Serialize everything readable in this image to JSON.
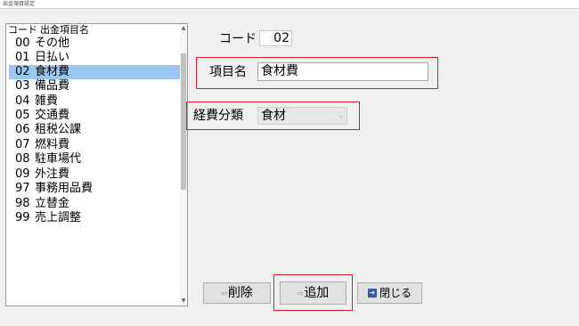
{
  "window": {
    "title": "出金項目設定"
  },
  "list": {
    "headers": [
      "コード",
      "出金項目名"
    ],
    "rows": [
      {
        "code": "00",
        "name": "その他"
      },
      {
        "code": "01",
        "name": "日払い"
      },
      {
        "code": "02",
        "name": "食材費"
      },
      {
        "code": "03",
        "name": "備品費"
      },
      {
        "code": "04",
        "name": "雑費"
      },
      {
        "code": "05",
        "name": "交通費"
      },
      {
        "code": "06",
        "name": "租税公課"
      },
      {
        "code": "07",
        "name": "燃料費"
      },
      {
        "code": "08",
        "name": "駐車場代"
      },
      {
        "code": "09",
        "name": "外注費"
      },
      {
        "code": "97",
        "name": "事務用品費"
      },
      {
        "code": "98",
        "name": "立替金"
      },
      {
        "code": "99",
        "name": "売上調整"
      }
    ],
    "selected_index": 2
  },
  "form": {
    "code_label": "コード",
    "code_value": "02",
    "item_label": "項目名",
    "item_value": "食材費",
    "category_label": "経費分類",
    "category_value": "食材"
  },
  "buttons": {
    "delete_label": "削除",
    "add_label": "追加",
    "close_label": "閉じる"
  },
  "colors": {
    "selected_row": "#99c8f2",
    "highlight_border": "#d61f2a",
    "close_icon": "#2f5da9"
  },
  "icons": {
    "scroll_up": "chevron-up-icon",
    "scroll_down": "chevron-down-icon",
    "dropdown": "chevron-down-icon",
    "delete": "delete-icon",
    "add": "add-icon",
    "close": "exit-icon"
  }
}
